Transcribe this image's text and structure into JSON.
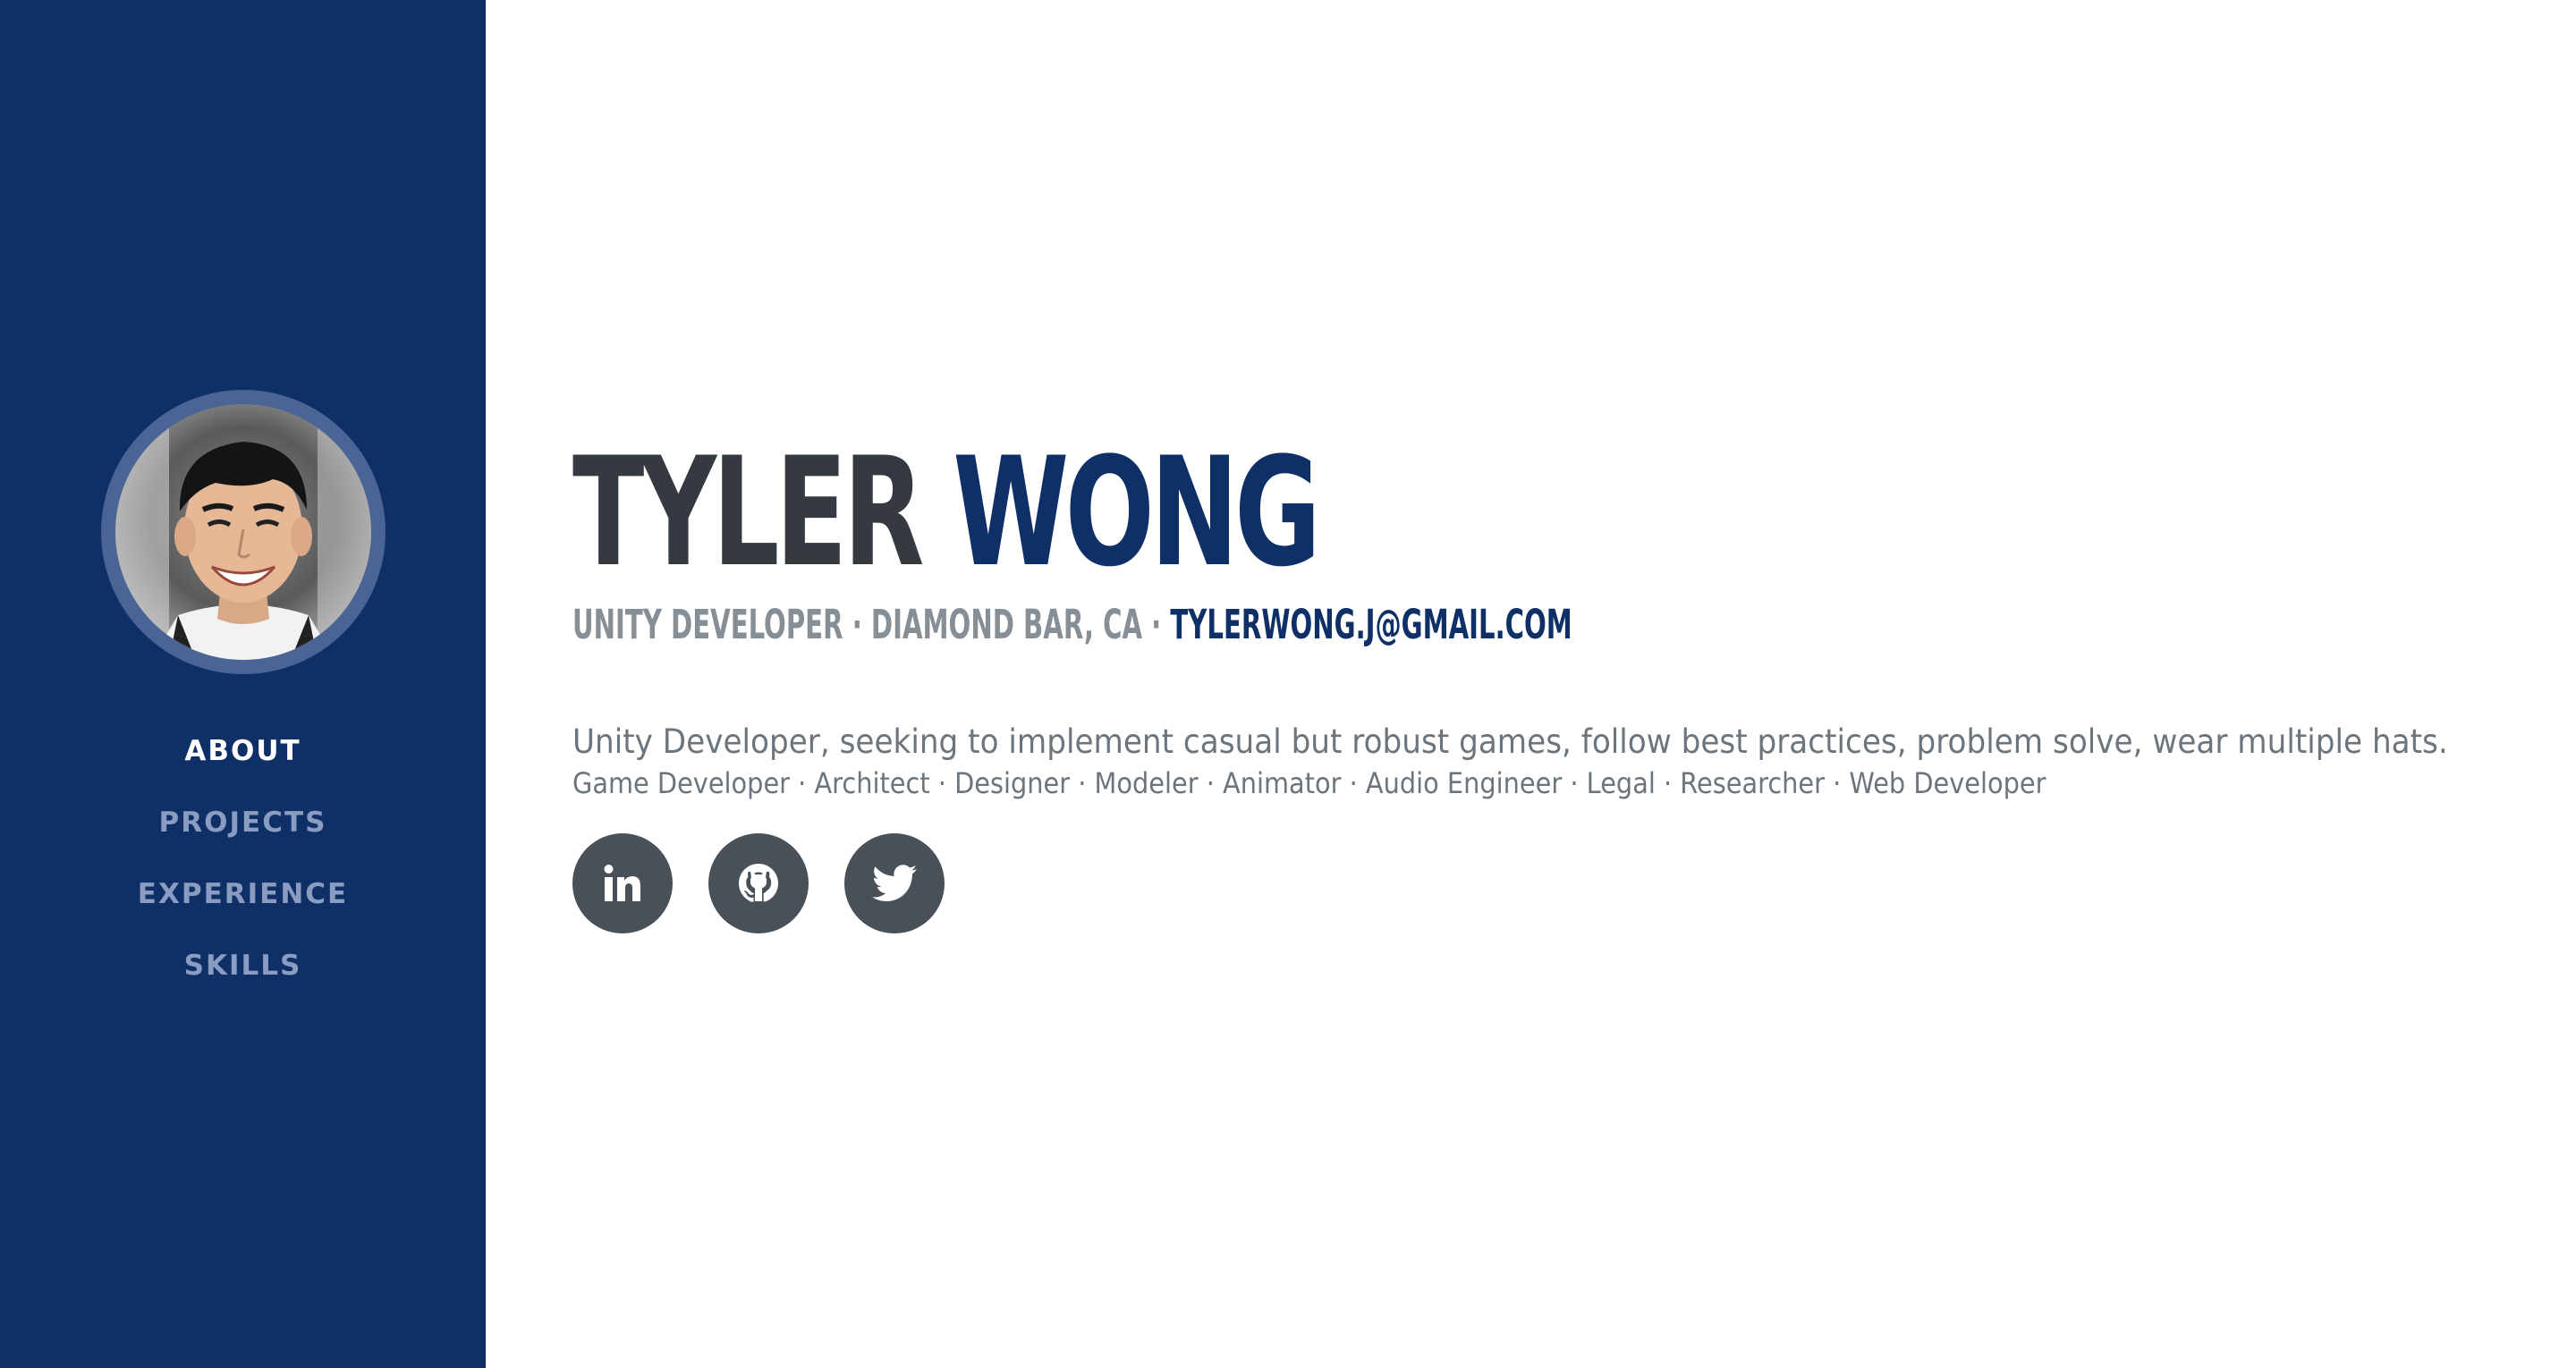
{
  "profile": {
    "first_name": "TYLER",
    "last_name": "WONG",
    "role": "Unity Developer",
    "location": "Diamond Bar, CA",
    "separator": " · ",
    "email": "tylerwong.j@gmail.com",
    "summary": "Unity Developer, seeking to implement casual but robust games, follow best practices, problem solve, wear multiple hats.",
    "roles": "Game Developer · Architect · Designer · Modeler · Animator · Audio Engineer · Legal · Researcher · Web Developer"
  },
  "nav": {
    "items": [
      {
        "label": "ABOUT",
        "active": true
      },
      {
        "label": "PROJECTS",
        "active": false
      },
      {
        "label": "EXPERIENCE",
        "active": false
      },
      {
        "label": "SKILLS",
        "active": false
      }
    ]
  },
  "socials": [
    {
      "icon": "linkedin-icon"
    },
    {
      "icon": "github-icon"
    },
    {
      "icon": "twitter-icon"
    }
  ],
  "colors": {
    "primary": "#0f3067",
    "avatar_ring": "#4a6496",
    "nav_inactive": "#8a9cc2",
    "heading_dark": "#343a40",
    "muted": "#868e96",
    "social_bg": "#495057"
  }
}
